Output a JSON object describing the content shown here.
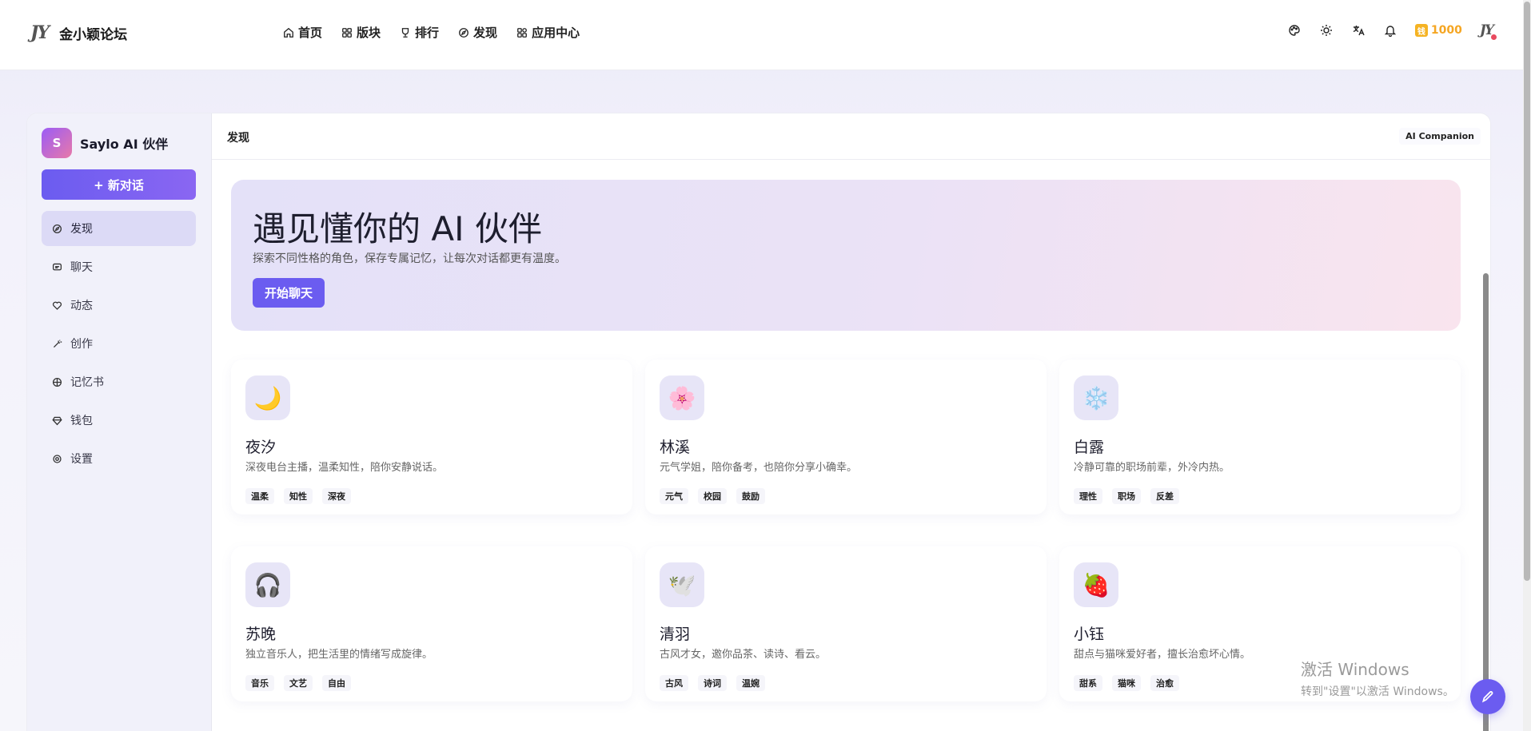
{
  "site": {
    "logo": "JY",
    "name": "金小颖论坛"
  },
  "menu": [
    {
      "id": "home",
      "label": "首页",
      "icon": "home-icon"
    },
    {
      "id": "boards",
      "label": "版块",
      "icon": "grid-icon"
    },
    {
      "id": "rank",
      "label": "排行",
      "icon": "trophy-icon"
    },
    {
      "id": "discover",
      "label": "发现",
      "icon": "compass-icon"
    },
    {
      "id": "apps",
      "label": "应用中心",
      "icon": "apps-icon"
    }
  ],
  "nav_right": {
    "coin_badge": "钱",
    "coins": "1000",
    "avatar": "JY"
  },
  "sidebar": {
    "logo_letter": "S",
    "title": "Saylo AI 伙伴",
    "new_chat": "+ 新对话",
    "items": [
      {
        "label": "发现",
        "icon": "compass-icon",
        "active": true
      },
      {
        "label": "聊天",
        "icon": "chat-icon"
      },
      {
        "label": "动态",
        "icon": "heart-icon"
      },
      {
        "label": "创作",
        "icon": "wand-icon"
      },
      {
        "label": "记忆书",
        "icon": "book-icon"
      },
      {
        "label": "钱包",
        "icon": "gem-icon"
      },
      {
        "label": "设置",
        "icon": "gear-icon"
      }
    ]
  },
  "header": {
    "title": "发现",
    "tag": "AI Companion"
  },
  "hero": {
    "title": "遇见懂你的 AI 伙伴",
    "subtitle": "探索不同性格的角色，保存专属记忆，让每次对话都更有温度。",
    "button": "开始聊天"
  },
  "cards": [
    {
      "emoji": "🌙",
      "name": "夜汐",
      "desc": "深夜电台主播，温柔知性，陪你安静说话。",
      "tags": [
        "温柔",
        "知性",
        "深夜"
      ]
    },
    {
      "emoji": "🌸",
      "name": "林溪",
      "desc": "元气学姐，陪你备考，也陪你分享小确幸。",
      "tags": [
        "元气",
        "校园",
        "鼓励"
      ]
    },
    {
      "emoji": "❄️",
      "name": "白露",
      "desc": "冷静可靠的职场前辈，外冷内热。",
      "tags": [
        "理性",
        "职场",
        "反差"
      ]
    },
    {
      "emoji": "🎧",
      "name": "苏晚",
      "desc": "独立音乐人，把生活里的情绪写成旋律。",
      "tags": [
        "音乐",
        "文艺",
        "自由"
      ]
    },
    {
      "emoji": "🕊️",
      "name": "清羽",
      "desc": "古风才女，邀你品茶、读诗、看云。",
      "tags": [
        "古风",
        "诗词",
        "温婉"
      ]
    },
    {
      "emoji": "🍓",
      "name": "小钰",
      "desc": "甜点与猫咪爱好者，擅长治愈坏心情。",
      "tags": [
        "甜系",
        "猫咪",
        "治愈"
      ]
    }
  ],
  "watermark": {
    "title": "激活 Windows",
    "subtitle": "转到\"设置\"以激活 Windows。"
  }
}
